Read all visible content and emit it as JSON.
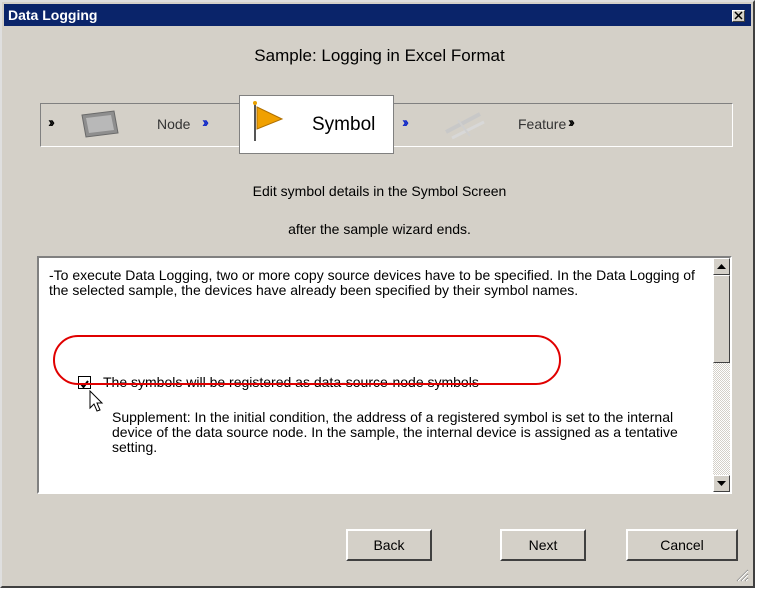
{
  "window": {
    "title": "Data Logging"
  },
  "wizard": {
    "title": "Sample: Logging in Excel Format"
  },
  "steps": [
    {
      "label": "Node",
      "state": "done"
    },
    {
      "label": "Symbol",
      "state": "active"
    },
    {
      "label": "Feature",
      "state": "pending"
    }
  ],
  "description": {
    "line1": "Edit symbol details in the Symbol Screen",
    "line2": "after the sample wizard ends."
  },
  "content": {
    "paragraph": "-To execute Data Logging, two or more copy source devices have to be specified. In the Data Logging of the selected sample, the devices have already been specified by their symbol names.",
    "checkbox": {
      "label": "The symbols will be registered as data-source-node symbols",
      "checked": true
    },
    "supplement": "Supplement: In the initial condition, the address of a registered symbol is set to the internal device of the data source node. In the sample, the internal device is assigned as a tentative setting."
  },
  "buttons": {
    "back": "Back",
    "next": "Next",
    "cancel": "Cancel"
  },
  "colors": {
    "titlebar": "#0a246a",
    "highlight": "#e00000",
    "step_arrow": "#1028c8"
  },
  "icons": [
    "close-icon",
    "monitor-icon",
    "flag-icon",
    "pen-tools-icon",
    "cursor-icon",
    "scroll-up-icon",
    "scroll-down-icon",
    "resize-grip-icon"
  ]
}
